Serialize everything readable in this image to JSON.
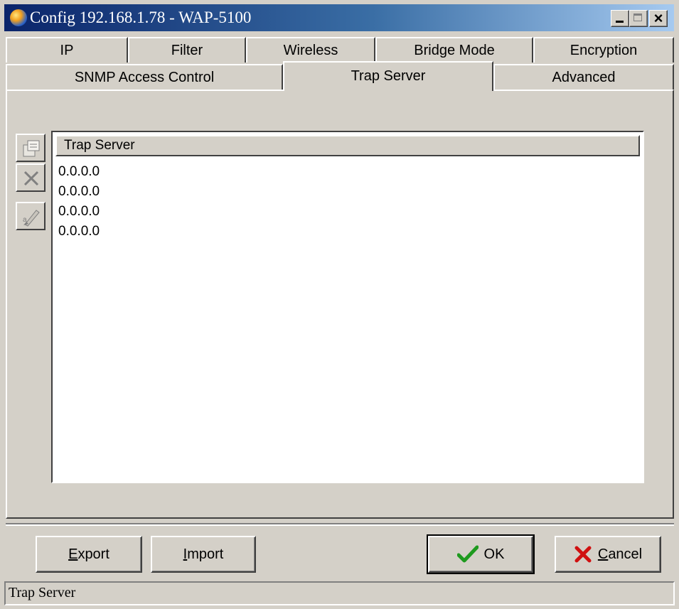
{
  "window": {
    "title": "Config 192.168.1.78 - WAP-5100",
    "controls": {
      "minimize": "minimize",
      "maximize": "maximize",
      "close": "×"
    }
  },
  "tabs_row1": [
    {
      "label": "IP"
    },
    {
      "label": "Filter"
    },
    {
      "label": "Wireless"
    },
    {
      "label": "Bridge Mode"
    },
    {
      "label": "Encryption"
    }
  ],
  "tabs_row2": [
    {
      "label": "SNMP Access Control"
    },
    {
      "label": "Trap Server",
      "active": true
    },
    {
      "label": "Advanced"
    }
  ],
  "toolbar": {
    "icons": [
      "properties-icon",
      "delete-icon",
      "edit-icon"
    ]
  },
  "list": {
    "header": "Trap Server",
    "rows": [
      "0.0.0.0",
      "0.0.0.0",
      "0.0.0.0",
      "0.0.0.0"
    ]
  },
  "buttons": {
    "export": {
      "accel": "E",
      "rest": "xport"
    },
    "import": {
      "accel": "I",
      "rest": "mport"
    },
    "ok": {
      "label": "OK"
    },
    "cancel": {
      "accel": "C",
      "rest": "ancel"
    }
  },
  "colors": {
    "ok_check": "#1e9a1e",
    "cancel_x": "#d01010",
    "title_bar_start": "#0a246a"
  },
  "status_bar": {
    "text": "Trap Server"
  }
}
